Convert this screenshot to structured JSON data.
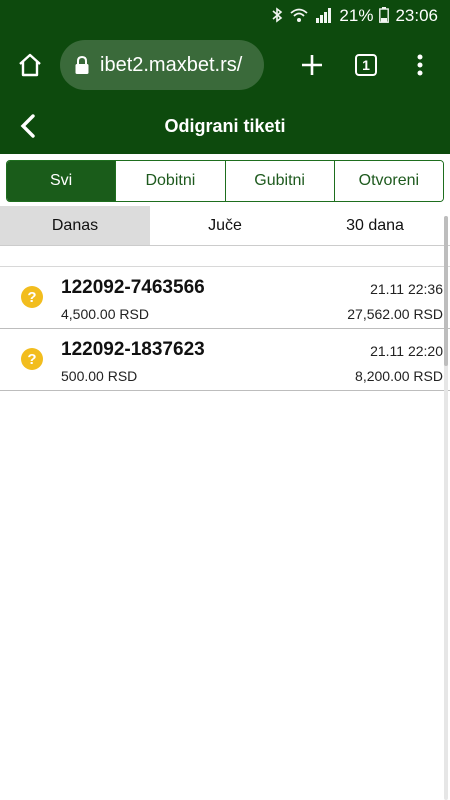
{
  "status_bar": {
    "battery": "21%",
    "time": "23:06",
    "icons": [
      "bluetooth-icon",
      "wifi-icon",
      "signal-icon",
      "battery-icon"
    ]
  },
  "browser": {
    "url": "ibet2.maxbet.rs/",
    "tab_count": "1",
    "icons": [
      "home-icon",
      "lock-icon",
      "plus-icon",
      "tabs-icon",
      "menu-dots-icon"
    ]
  },
  "header": {
    "title": "Odigrani tiketi",
    "back_icon": "chevron-left-icon"
  },
  "filter_tabs": [
    {
      "label": "Svi",
      "active": true
    },
    {
      "label": "Dobitni",
      "active": false
    },
    {
      "label": "Gubitni",
      "active": false
    },
    {
      "label": "Otvoreni",
      "active": false
    }
  ],
  "period_tabs": [
    {
      "label": "Danas",
      "active": true
    },
    {
      "label": "Juče",
      "active": false
    },
    {
      "label": "30 dana",
      "active": false
    }
  ],
  "tickets": [
    {
      "id": "122092-7463566",
      "stake": "4,500.00 RSD",
      "datetime": "21.11 22:36",
      "payout": "27,562.00 RSD",
      "status_icon": "question-icon"
    },
    {
      "id": "122092-1837623",
      "stake": "500.00 RSD",
      "datetime": "21.11 22:20",
      "payout": "8,200.00 RSD",
      "status_icon": "question-icon"
    }
  ],
  "colors": {
    "brand_green": "#0d4a0d",
    "active_tab": "#1a5c1a",
    "pending_yellow": "#f2bd1e"
  }
}
